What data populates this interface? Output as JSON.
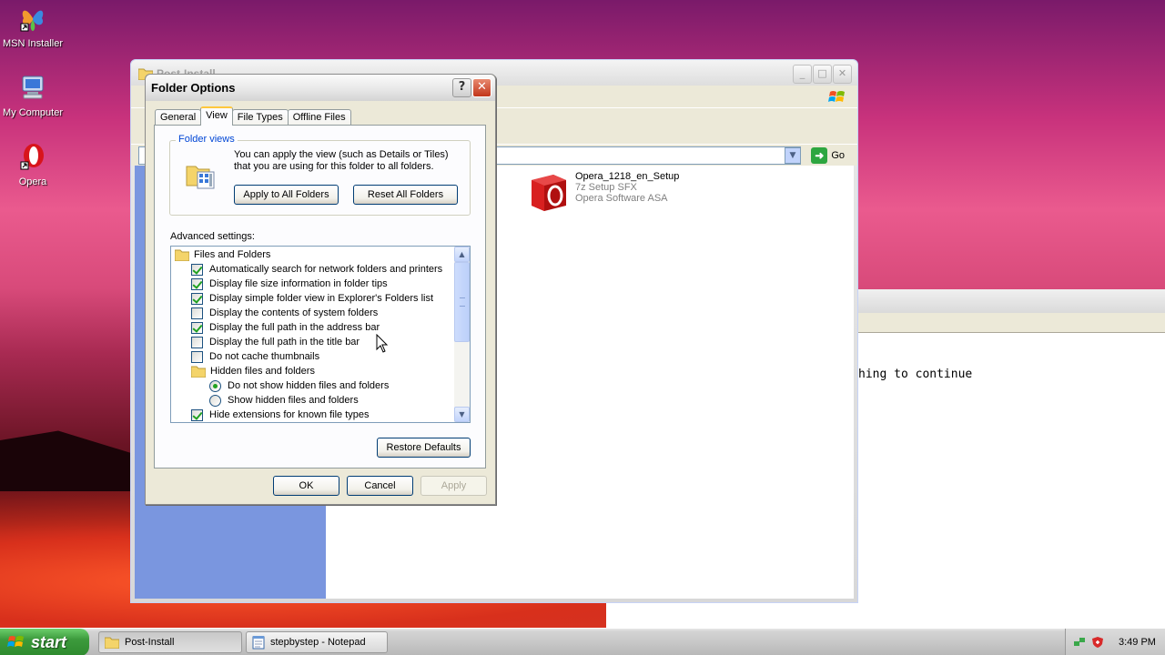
{
  "desktop": {
    "icons": [
      {
        "label": "MSN Installer",
        "icon": "msn-butterfly-icon"
      },
      {
        "label": "My Computer",
        "icon": "my-computer-icon"
      },
      {
        "label": "Opera",
        "icon": "opera-icon"
      }
    ]
  },
  "explorer": {
    "title": "Post-Install",
    "go_label": "Go",
    "file": {
      "name": "Opera_1218_en_Setup",
      "type": "7z Setup SFX",
      "company": "Opera Software ASA"
    }
  },
  "notepad": {
    "visible_text": "hing to continue"
  },
  "dialog": {
    "title": "Folder Options",
    "tabs": [
      {
        "label": "General",
        "active": false
      },
      {
        "label": "View",
        "active": true
      },
      {
        "label": "File Types",
        "active": false
      },
      {
        "label": "Offline Files",
        "active": false
      }
    ],
    "folder_views": {
      "legend": "Folder views",
      "description": "You can apply the view (such as Details or Tiles) that you are using for this folder to all folders.",
      "apply_all_label": "Apply to All Folders",
      "reset_all_label": "Reset All Folders"
    },
    "advanced_label": "Advanced settings:",
    "advanced_items": [
      {
        "kind": "folder",
        "label": "Files and Folders",
        "indent": 0
      },
      {
        "kind": "checkbox",
        "label": "Automatically search for network folders and printers",
        "checked": true,
        "indent": 1
      },
      {
        "kind": "checkbox",
        "label": "Display file size information in folder tips",
        "checked": true,
        "indent": 1
      },
      {
        "kind": "checkbox",
        "label": "Display simple folder view in Explorer's Folders list",
        "checked": true,
        "indent": 1
      },
      {
        "kind": "checkbox",
        "label": "Display the contents of system folders",
        "checked": false,
        "indent": 1
      },
      {
        "kind": "checkbox",
        "label": "Display the full path in the address bar",
        "checked": true,
        "indent": 1
      },
      {
        "kind": "checkbox",
        "label": "Display the full path in the title bar",
        "checked": false,
        "indent": 1
      },
      {
        "kind": "checkbox",
        "label": "Do not cache thumbnails",
        "checked": false,
        "indent": 1
      },
      {
        "kind": "folder",
        "label": "Hidden files and folders",
        "indent": 1
      },
      {
        "kind": "radio",
        "label": "Do not show hidden files and folders",
        "checked": true,
        "indent": 2
      },
      {
        "kind": "radio",
        "label": "Show hidden files and folders",
        "checked": false,
        "indent": 2
      },
      {
        "kind": "checkbox",
        "label": "Hide extensions for known file types",
        "checked": true,
        "indent": 1
      }
    ],
    "restore_defaults_label": "Restore Defaults",
    "ok_label": "OK",
    "cancel_label": "Cancel",
    "apply_label": "Apply"
  },
  "taskbar": {
    "start_label": "start",
    "tasks": [
      {
        "label": "Post-Install",
        "icon": "folder-icon"
      },
      {
        "label": "stepbystep - Notepad",
        "icon": "notepad-icon"
      }
    ],
    "clock": "3:49 PM"
  },
  "colors": {
    "accent_tab": "#ffc83c",
    "legend_blue": "#0046d5",
    "check_green": "#21a121"
  }
}
